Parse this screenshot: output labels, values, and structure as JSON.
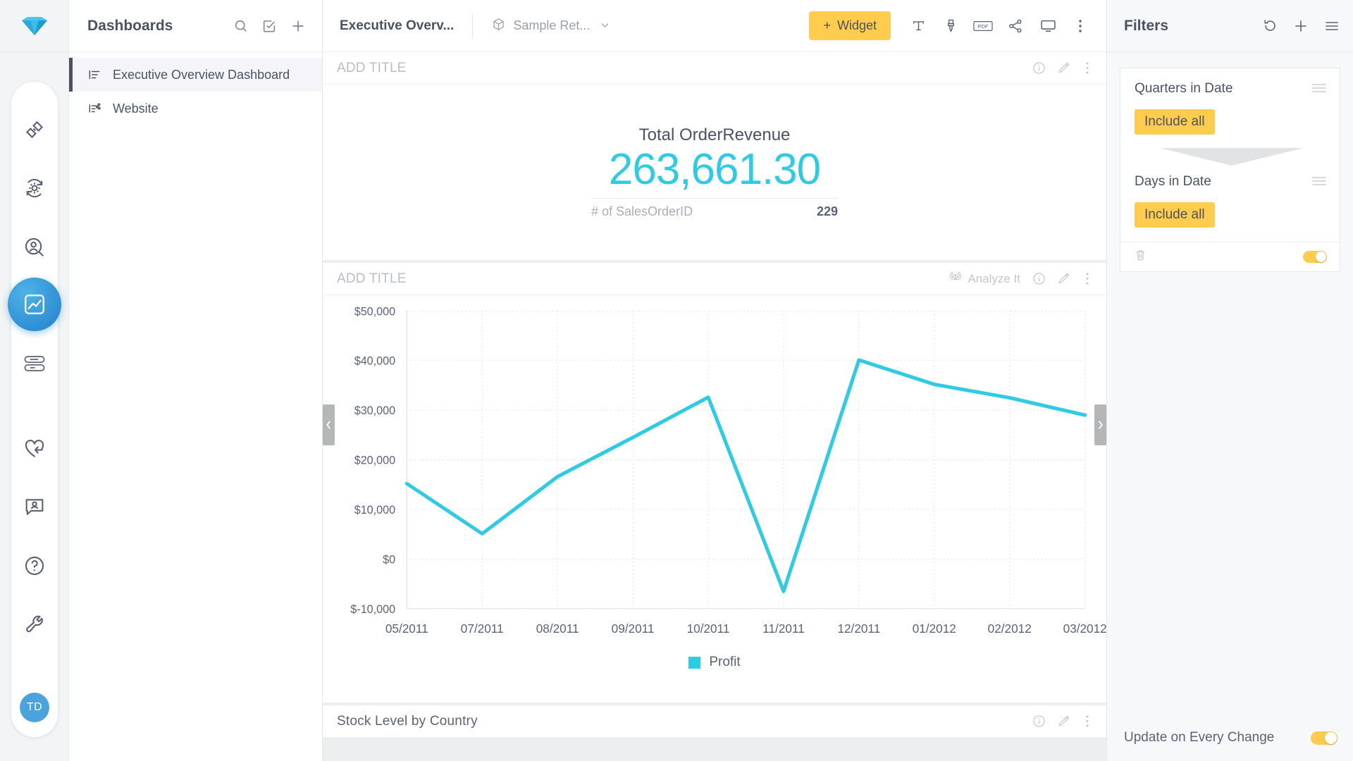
{
  "brand": {
    "logo_icon": "diamond-logo",
    "accent_yellow": "#ffcc4d",
    "accent_cyan": "#2ecbe4",
    "accent_blue": "#2f8fd4"
  },
  "rail": {
    "items": [
      {
        "icon": "connectors-icon",
        "name": "connectors"
      },
      {
        "icon": "elasticube-gear-icon",
        "name": "data-models"
      },
      {
        "icon": "user-search-icon",
        "name": "user-search"
      },
      {
        "icon": "analytics-chart-icon",
        "name": "analytics",
        "active": true
      },
      {
        "icon": "pills-data-icon",
        "name": "data"
      },
      {
        "icon": "heart-reply-icon",
        "name": "pulse"
      },
      {
        "icon": "user-chat-icon",
        "name": "user-chat"
      },
      {
        "icon": "help-circle-icon",
        "name": "help"
      },
      {
        "icon": "wrench-icon",
        "name": "admin"
      }
    ],
    "avatar_initials": "TD"
  },
  "sidebar": {
    "title": "Dashboards",
    "icons": [
      {
        "name": "search-icon"
      },
      {
        "name": "select-checkbox-icon"
      },
      {
        "name": "plus-icon"
      }
    ],
    "items": [
      {
        "label": "Executive Overview Dashboard",
        "icon": "dashboard-list-icon",
        "selected": true
      },
      {
        "label": "Website",
        "icon": "shared-dashboard-icon",
        "selected": false
      }
    ]
  },
  "topbar": {
    "dashboard_title": "Executive Overv...",
    "datasource": "Sample Ret...",
    "datasource_icon": "cube-icon",
    "caret_icon": "chevron-down-icon",
    "add_widget_label": "Widget",
    "add_widget_plus": "+",
    "tools": [
      {
        "name": "text-widget-icon",
        "label": "T"
      },
      {
        "name": "paintbrush-icon",
        "label": ""
      },
      {
        "name": "pdf-export-icon",
        "label": "PDF"
      },
      {
        "name": "share-icon",
        "label": ""
      },
      {
        "name": "presentation-icon",
        "label": ""
      },
      {
        "name": "more-vertical-icon",
        "label": ""
      }
    ]
  },
  "canvas": {
    "handle_left_icon": "chevron-left-icon",
    "handle_right_icon": "chevron-right-icon",
    "widgets": [
      {
        "title": "ADD TITLE",
        "is_placeholder_title": true,
        "type": "indicator",
        "kpi": {
          "label": "Total OrderRevenue",
          "value": "263,661.30",
          "secondary_label": "# of SalesOrderID",
          "secondary_value": "229"
        },
        "actions": [
          {
            "name": "info-icon"
          },
          {
            "name": "edit-pencil-icon"
          },
          {
            "name": "more-vertical-icon"
          }
        ]
      },
      {
        "title": "ADD TITLE",
        "is_placeholder_title": true,
        "type": "line",
        "analyze_it_label": "Analyze It",
        "analyze_it_icon": "owl-icon",
        "actions": [
          {
            "name": "info-icon"
          },
          {
            "name": "edit-pencil-icon"
          },
          {
            "name": "more-vertical-icon"
          }
        ]
      },
      {
        "title": "Stock Level by Country",
        "is_placeholder_title": false,
        "type": "chart",
        "actions": [
          {
            "name": "info-icon"
          },
          {
            "name": "edit-pencil-icon"
          },
          {
            "name": "more-vertical-icon"
          }
        ]
      }
    ]
  },
  "chart_data": {
    "type": "line",
    "title": "",
    "xlabel": "",
    "ylabel": "",
    "x": [
      "05/2011",
      "07/2011",
      "08/2011",
      "09/2011",
      "10/2011",
      "11/2011",
      "12/2011",
      "01/2012",
      "02/2012",
      "03/2012"
    ],
    "series": [
      {
        "name": "Profit",
        "color": "#2ecbe4",
        "values": [
          15200,
          5100,
          16600,
          24500,
          32600,
          -6500,
          40100,
          35200,
          32500,
          29000
        ]
      }
    ],
    "ylim": [
      -10000,
      50000
    ],
    "yticks": [
      50000,
      40000,
      30000,
      20000,
      10000,
      0,
      -10000
    ],
    "ytick_labels": [
      "$50,000",
      "$40,000",
      "$30,000",
      "$20,000",
      "$10,000",
      "$0",
      "$-10,000"
    ],
    "grid": true,
    "legend": "bottom-center",
    "legend_entries": [
      "Profit"
    ]
  },
  "filters": {
    "title": "Filters",
    "header_icons": [
      {
        "name": "refresh-icon"
      },
      {
        "name": "plus-icon"
      },
      {
        "name": "hamburger-menu-icon"
      }
    ],
    "items": [
      {
        "name": "Quarters in Date",
        "value_label": "Include all",
        "menu_icon": "filter-menu-icon"
      },
      {
        "name": "Days in Date",
        "value_label": "Include all",
        "menu_icon": "filter-menu-icon"
      }
    ],
    "footer": {
      "delete_icon": "trash-icon",
      "toggle_on": true
    },
    "update_label": "Update on Every Change",
    "update_toggle_on": true
  }
}
